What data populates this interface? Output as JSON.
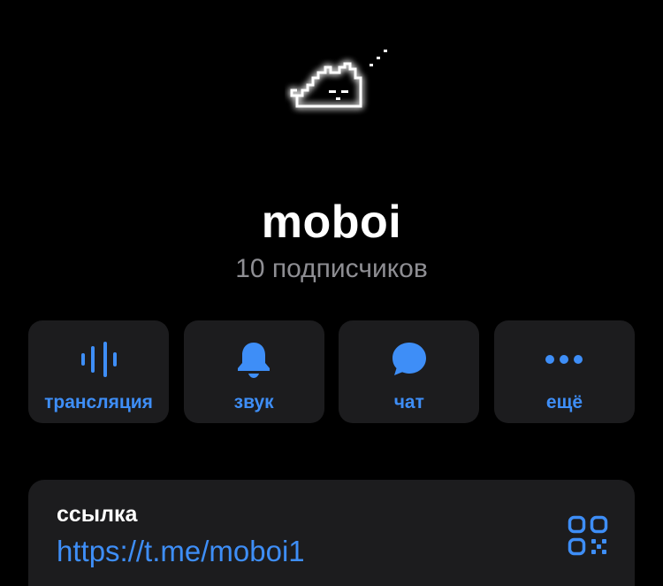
{
  "channel": {
    "name": "moboi",
    "subscribers": "10 подписчиков",
    "avatar_icon": "sleeping-cat-icon"
  },
  "actions": [
    {
      "label": "трансляция",
      "icon": "voice-chat-icon"
    },
    {
      "label": "звук",
      "icon": "bell-icon"
    },
    {
      "label": "чат",
      "icon": "chat-bubble-icon"
    },
    {
      "label": "ещё",
      "icon": "more-dots-icon"
    }
  ],
  "link": {
    "caption": "ссылка",
    "url": "https://t.me/moboi1",
    "qr_icon": "qr-code-icon"
  },
  "colors": {
    "background": "#000000",
    "card": "#1c1c1e",
    "accent": "#3e8ef7",
    "secondary_text": "#8e8e93",
    "primary_text": "#ffffff"
  }
}
